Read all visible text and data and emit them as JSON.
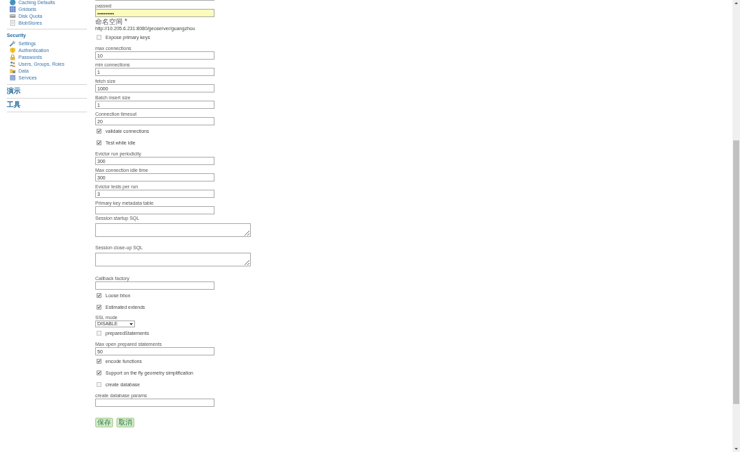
{
  "sidebar": {
    "sections": [
      {
        "items": [
          {
            "label": "Caching Defaults"
          },
          {
            "label": "Gridsets"
          },
          {
            "label": "Disk Quota"
          },
          {
            "label": "BlobStores"
          }
        ]
      },
      {
        "title": "Security",
        "items": [
          {
            "label": "Settings"
          },
          {
            "label": "Authentication"
          },
          {
            "label": "Passwords"
          },
          {
            "label": "Users, Groups, Roles"
          },
          {
            "label": "Data"
          },
          {
            "label": "Services"
          }
        ]
      },
      {
        "title": "演示"
      },
      {
        "title": "工具"
      }
    ]
  },
  "form": {
    "fields": [
      {
        "kind": "text"
      },
      {
        "kind": "password",
        "label": "passwd",
        "value": "••••••••••"
      },
      {
        "kind": "info",
        "label": "命名空间 *",
        "value": "http://10.205.6.231:8080/geoserver/guangzhou"
      },
      {
        "kind": "checkbox",
        "label": "Expose primary keys",
        "checked": false
      },
      {
        "kind": "text",
        "label": "max connections",
        "value": "10"
      },
      {
        "kind": "text",
        "label": "min connections",
        "value": "1"
      },
      {
        "kind": "text",
        "label": "fetch size",
        "value": "1000"
      },
      {
        "kind": "text",
        "label": "Batch insert size",
        "value": "1"
      },
      {
        "kind": "text",
        "label": "Connection timeout",
        "value": "20"
      },
      {
        "kind": "checkbox",
        "label": "validate connections",
        "checked": true
      },
      {
        "kind": "checkbox",
        "label": "Test while idle",
        "checked": true
      },
      {
        "kind": "text",
        "label": "Evictor run periodicity",
        "value": "300"
      },
      {
        "kind": "text",
        "label": "Max connection idle time",
        "value": "300"
      },
      {
        "kind": "text",
        "label": "Evictor tests per run",
        "value": "3"
      },
      {
        "kind": "text",
        "label": "Primary key metadata table"
      },
      {
        "kind": "textarea",
        "label": "Session startup SQL"
      },
      {
        "kind": "textarea",
        "label": "Session close-up SQL"
      },
      {
        "kind": "text",
        "label": "Callback factory"
      },
      {
        "kind": "checkbox",
        "label": "Loose bbox",
        "checked": true
      },
      {
        "kind": "checkbox",
        "label": "Estimated extends",
        "checked": true
      },
      {
        "kind": "select",
        "label": "SSL mode",
        "value": "DISABLE"
      },
      {
        "kind": "checkbox",
        "label": "preparedStatements",
        "checked": false
      },
      {
        "kind": "text",
        "label": "Max open prepared statements",
        "value": "50"
      },
      {
        "kind": "checkbox",
        "label": "encode functions",
        "checked": true
      },
      {
        "kind": "checkbox",
        "label": "Support on the fly geometry simplification",
        "checked": true
      },
      {
        "kind": "checkbox",
        "label": "create database",
        "checked": false
      },
      {
        "kind": "text",
        "label": "create database params"
      }
    ],
    "buttons": [
      {
        "label": "保存"
      },
      {
        "label": "取消"
      }
    ]
  }
}
